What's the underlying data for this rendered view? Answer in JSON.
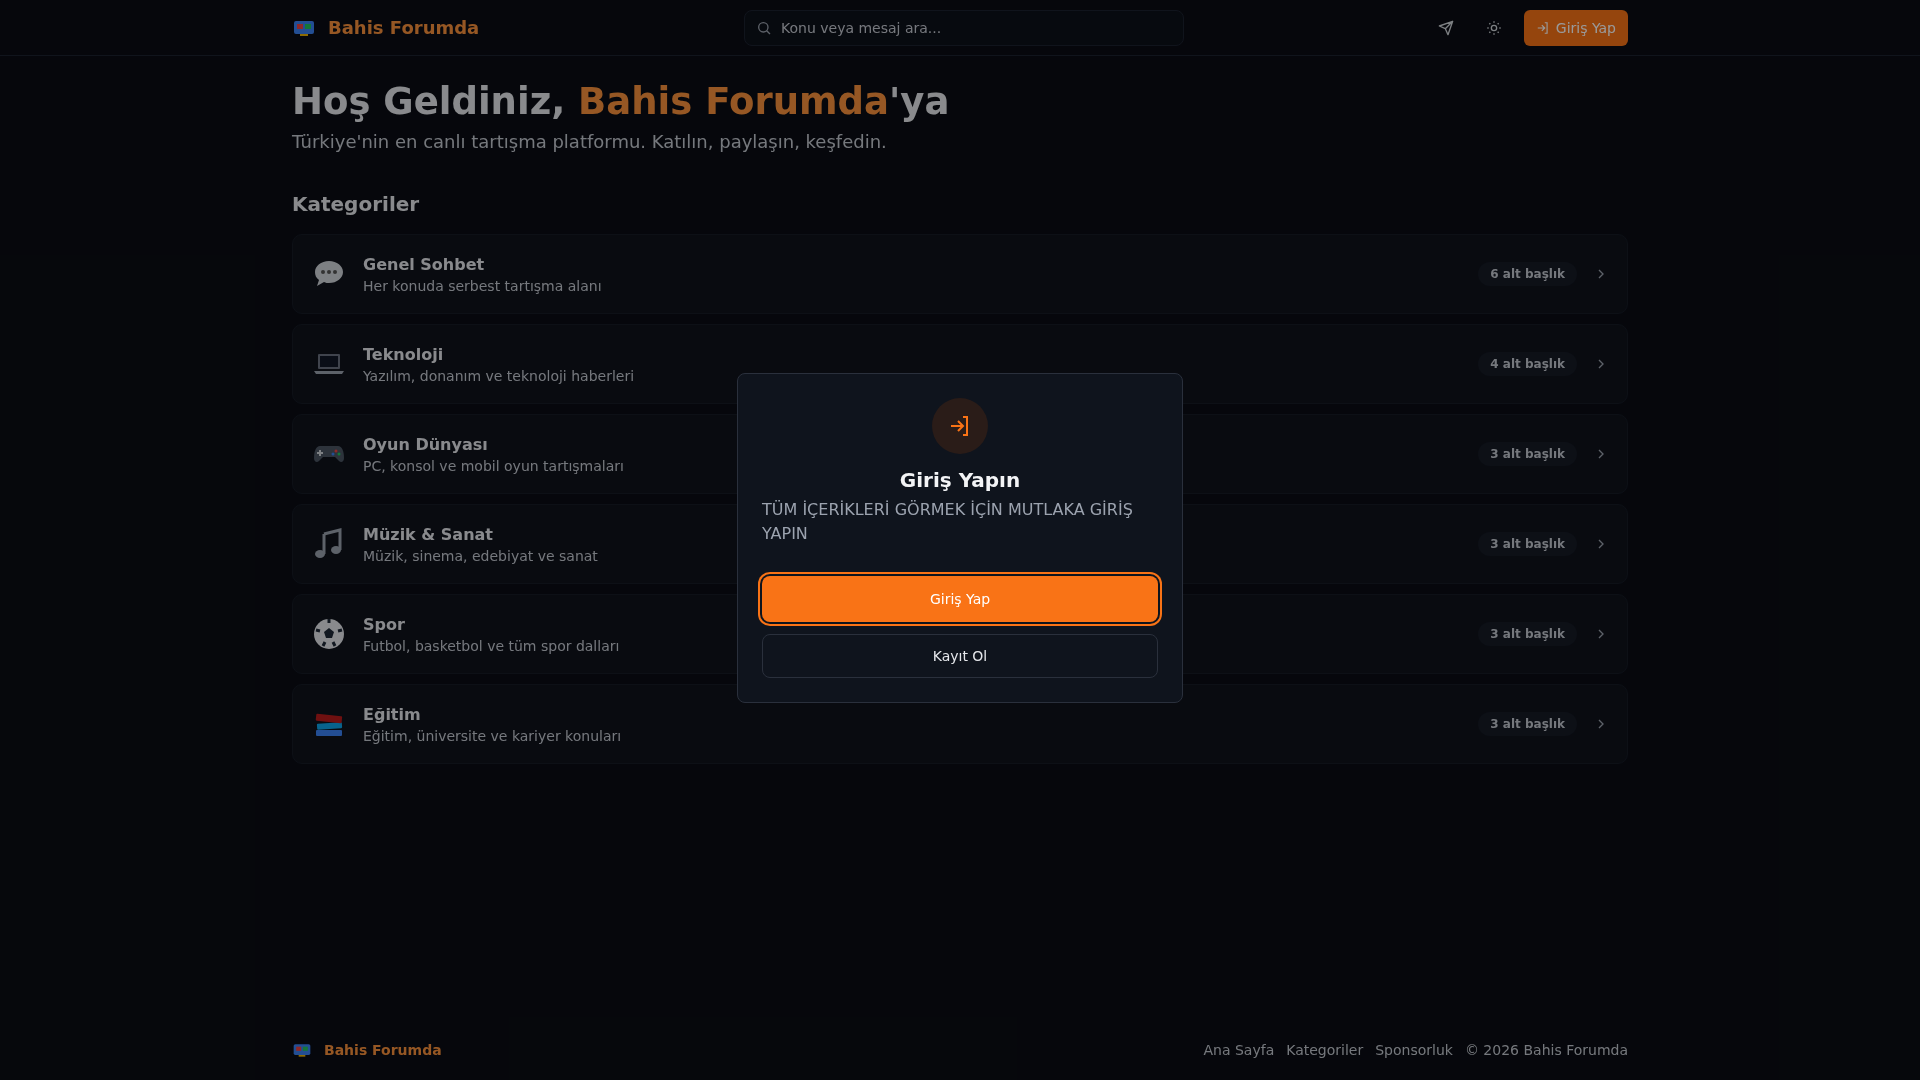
{
  "header": {
    "brand": "Bahis Forumda",
    "search": {
      "placeholder": "Konu veya mesaj ara..."
    },
    "login_button": "Giriş Yap"
  },
  "hero": {
    "title_before": "Hoş Geldiniz, ",
    "title_highlight": "Bahis Forumda",
    "title_after": "'ya",
    "subtitle": "Türkiye'nin en canlı tartışma platformu. Katılın, paylaşın, keşfedin."
  },
  "categories_heading": "Kategoriler",
  "categories": [
    {
      "kind": "chat",
      "name": "Genel Sohbet",
      "description": "Her konuda serbest tartışma alanı",
      "count": "6 alt başlık"
    },
    {
      "kind": "laptop",
      "name": "Teknoloji",
      "description": "Yazılım, donanım ve teknoloji haberleri",
      "count": "4 alt başlık"
    },
    {
      "kind": "gamepad",
      "name": "Oyun Dünyası",
      "description": "PC, konsol ve mobil oyun tartışmaları",
      "count": "3 alt başlık"
    },
    {
      "kind": "music",
      "name": "Müzik & Sanat",
      "description": "Müzik, sinema, edebiyat ve sanat",
      "count": "3 alt başlık"
    },
    {
      "kind": "ball",
      "name": "Spor",
      "description": "Futbol, basketbol ve tüm spor dalları",
      "count": "3 alt başlık"
    },
    {
      "kind": "books",
      "name": "Eğitim",
      "description": "Eğitim, üniversite ve kariyer konuları",
      "count": "3 alt başlık"
    }
  ],
  "footer": {
    "brand": "Bahis Forumda",
    "links": [
      "Ana Sayfa",
      "Kategoriler",
      "Sponsorluk"
    ],
    "copyright": "© 2026 Bahis Forumda"
  },
  "modal": {
    "title": "Giriş Yapın",
    "message": "TÜM İÇERİKLERİ GÖRMEK İÇİN MUTLAKA GİRİŞ YAPIN",
    "primary_button": "Giriş Yap",
    "secondary_button": "Kayıt Ol"
  }
}
